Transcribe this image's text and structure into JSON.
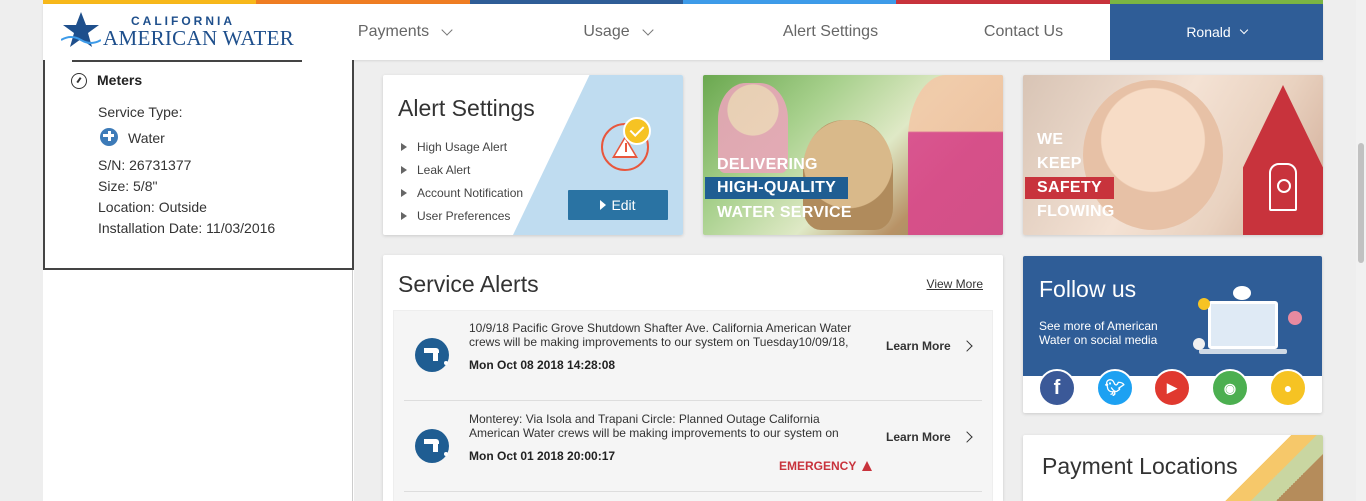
{
  "colors": {
    "strip": [
      "#f7b81b",
      "#ef7d22",
      "#2f5d97",
      "#3d9be9",
      "#c8333c",
      "#7bb542"
    ],
    "brand_blue": "#2f5d97",
    "alert_red": "#c8333c",
    "edit_button": "#2a73a3"
  },
  "logo": {
    "line1": "CALIFORNIA",
    "line2": "AMERICAN WATER"
  },
  "nav": {
    "payments": "Payments",
    "usage": "Usage",
    "alert_settings": "Alert Settings",
    "contact": "Contact Us",
    "user": "Ronald"
  },
  "meter": {
    "title": "Meters",
    "service_type_label": "Service Type:",
    "service_type": "Water",
    "serial": "S/N: 26731377",
    "size": "Size: 5/8\"",
    "location": "Location: Outside",
    "install_date": "Installation Date: 11/03/2016"
  },
  "alert_settings": {
    "title": "Alert Settings",
    "items": [
      "High Usage Alert",
      "Leak Alert",
      "Account Notification",
      "User Preferences"
    ],
    "edit_label": "Edit"
  },
  "promo1": {
    "line1": "DELIVERING",
    "line2": "HIGH-QUALITY",
    "line3": "WATER SERVICE"
  },
  "promo2": {
    "line1": "WE",
    "line2": "KEEP",
    "line3": "SAFETY",
    "line4": "FLOWING"
  },
  "service_alerts": {
    "title": "Service Alerts",
    "view_more": "View More",
    "items": [
      {
        "text": "10/9/18 Pacific Grove Shutdown Shafter Ave. California American Water crews will be making improvements to our system on Tuesday10/09/18, in",
        "date": "Mon Oct 08 2018 14:28:08",
        "learn_more": "Learn More",
        "badge": ""
      },
      {
        "text": "Monterey: Via Isola and Trapani Circle: Planned Outage California American Water crews will be making improvements to our system on",
        "date": "Mon Oct 01 2018 20:00:17",
        "learn_more": "Learn More",
        "badge": "EMERGENCY"
      }
    ]
  },
  "follow": {
    "title": "Follow us",
    "subtitle": "See more of American Water on social media",
    "networks": [
      {
        "icon": "facebook-icon",
        "color": "#3b5998",
        "glyph": "f"
      },
      {
        "icon": "twitter-icon",
        "color": "#1da1f2",
        "glyph": "t"
      },
      {
        "icon": "youtube-icon",
        "color": "#e0392f",
        "glyph": "▶"
      },
      {
        "icon": "rss-icon",
        "color": "#4caf50",
        "glyph": "◉"
      },
      {
        "icon": "duck-icon",
        "color": "#f6c323",
        "glyph": "●"
      }
    ]
  },
  "payment": {
    "title": "Payment Locations"
  }
}
